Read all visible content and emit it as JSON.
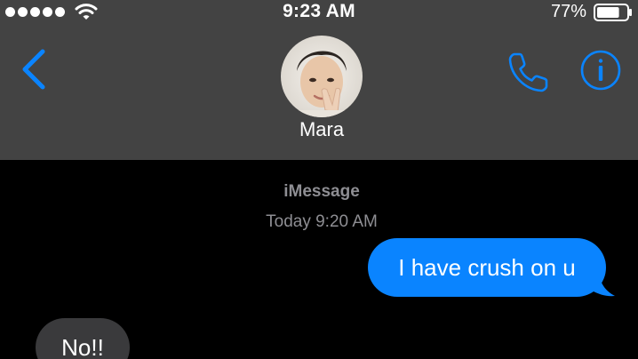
{
  "status_bar": {
    "signal_icon": "signal-dots-icon",
    "wifi_icon": "wifi-icon",
    "time": "9:23 AM",
    "battery_percent": "77%",
    "battery_icon": "battery-icon",
    "battery_level": 0.77
  },
  "header": {
    "back_icon": "chevron-left-icon",
    "contact_name": "Mara",
    "call_icon": "phone-icon",
    "info_icon": "info-icon",
    "background_color": "#434343",
    "accent_color": "#0a84ff"
  },
  "conversation": {
    "service_label": "iMessage",
    "timestamp": "Today 9:20 AM",
    "messages": [
      {
        "direction": "outgoing",
        "text": "I have crush on u",
        "color": "#0a84ff"
      },
      {
        "direction": "incoming",
        "text": "No!!",
        "color": "#3a3a3c"
      }
    ]
  }
}
